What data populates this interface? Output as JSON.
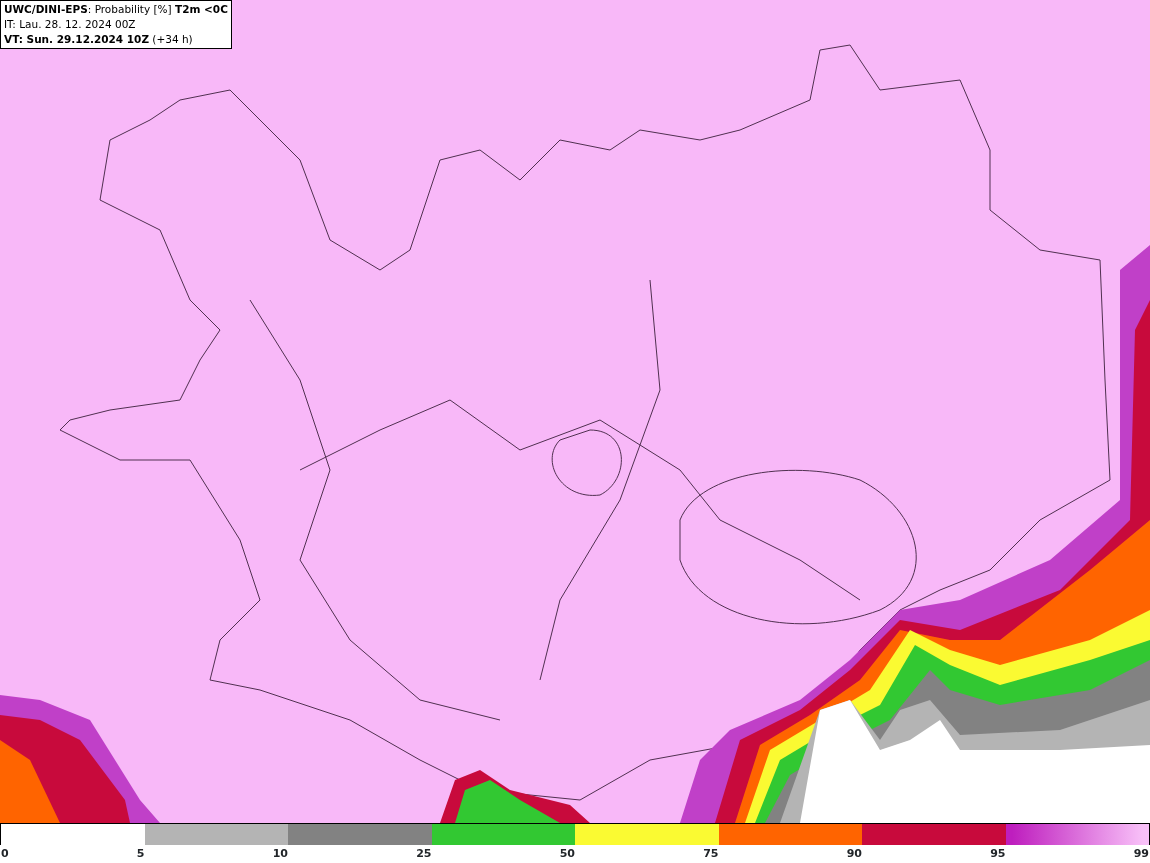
{
  "title_box": {
    "lines": [
      "**UWC/DINI-EPS**: Probability [%] **T2m <0C**",
      "IT: Lau. 28. 12. 2024 00Z",
      "**VT: Sun. 29.12.2024 10Z** (+34 h)"
    ]
  },
  "legend": {
    "segments": [
      {
        "color": "#ffffff"
      },
      {
        "color": "#b4b4b4"
      },
      {
        "color": "#828282"
      },
      {
        "color": "#32c832"
      },
      {
        "color": "#fafa32"
      },
      {
        "color": "#ff6400"
      },
      {
        "color": "#c80a3c"
      },
      {
        "color": "#be1ebe",
        "gradient_end": {
          "color": "#f8c0f8"
        }
      }
    ],
    "ticks": [
      "0",
      "5",
      "10",
      "25",
      "50",
      "75",
      "90",
      "95",
      "99"
    ]
  }
}
